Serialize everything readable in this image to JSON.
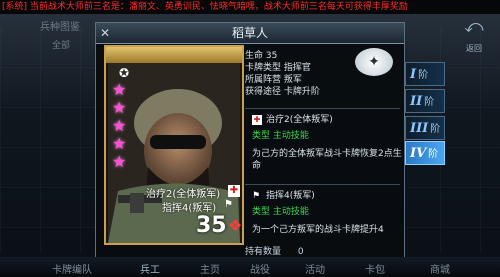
{
  "ticker": "[系统] 当前战术大师前三名是：潘丽文、英勇训民、怯晓气暗嘿，战术大师前三名每天可获得丰厚奖励",
  "background": {
    "tab_label": "兵种图鉴",
    "sub_label": "全部",
    "back_label": "返回"
  },
  "modal": {
    "title": "稻草人"
  },
  "card": {
    "skill_1": "治疗2(全体叛军)",
    "skill_2": "指挥4(叛军)",
    "cost": "35",
    "stars": 5
  },
  "info": {
    "lines": [
      "生命 35",
      "卡牌类型 指挥官",
      "所属阵营 叛军",
      "获得途径 卡牌升阶"
    ]
  },
  "skills": [
    {
      "name": "治疗2(全体叛军)",
      "type": "类型 主动技能",
      "desc": "为己方的全体叛军战斗卡牌恢复2点生命"
    },
    {
      "name": "指挥4(叛军)",
      "type": "类型 主动技能",
      "desc": "为一个己方叛军的战斗卡牌提升4"
    }
  ],
  "count": {
    "label": "持有数量",
    "value": "0"
  },
  "tiers": [
    {
      "roman": "I",
      "label": "阶",
      "active": false
    },
    {
      "roman": "II",
      "label": "阶",
      "active": false
    },
    {
      "roman": "III",
      "label": "阶",
      "active": false
    },
    {
      "roman": "IV",
      "label": "阶",
      "active": true
    }
  ],
  "bottom_nav": [
    "卡牌编队",
    "兵工",
    "主页",
    "战役",
    "活动",
    "卡包",
    "商城"
  ],
  "colors": {
    "ticker": "#ff2b2b",
    "star": "#ff4fd3",
    "skill_type": "#3ad94b",
    "tier_active": "#4aa6f0",
    "card_border": "#c9a14a"
  }
}
